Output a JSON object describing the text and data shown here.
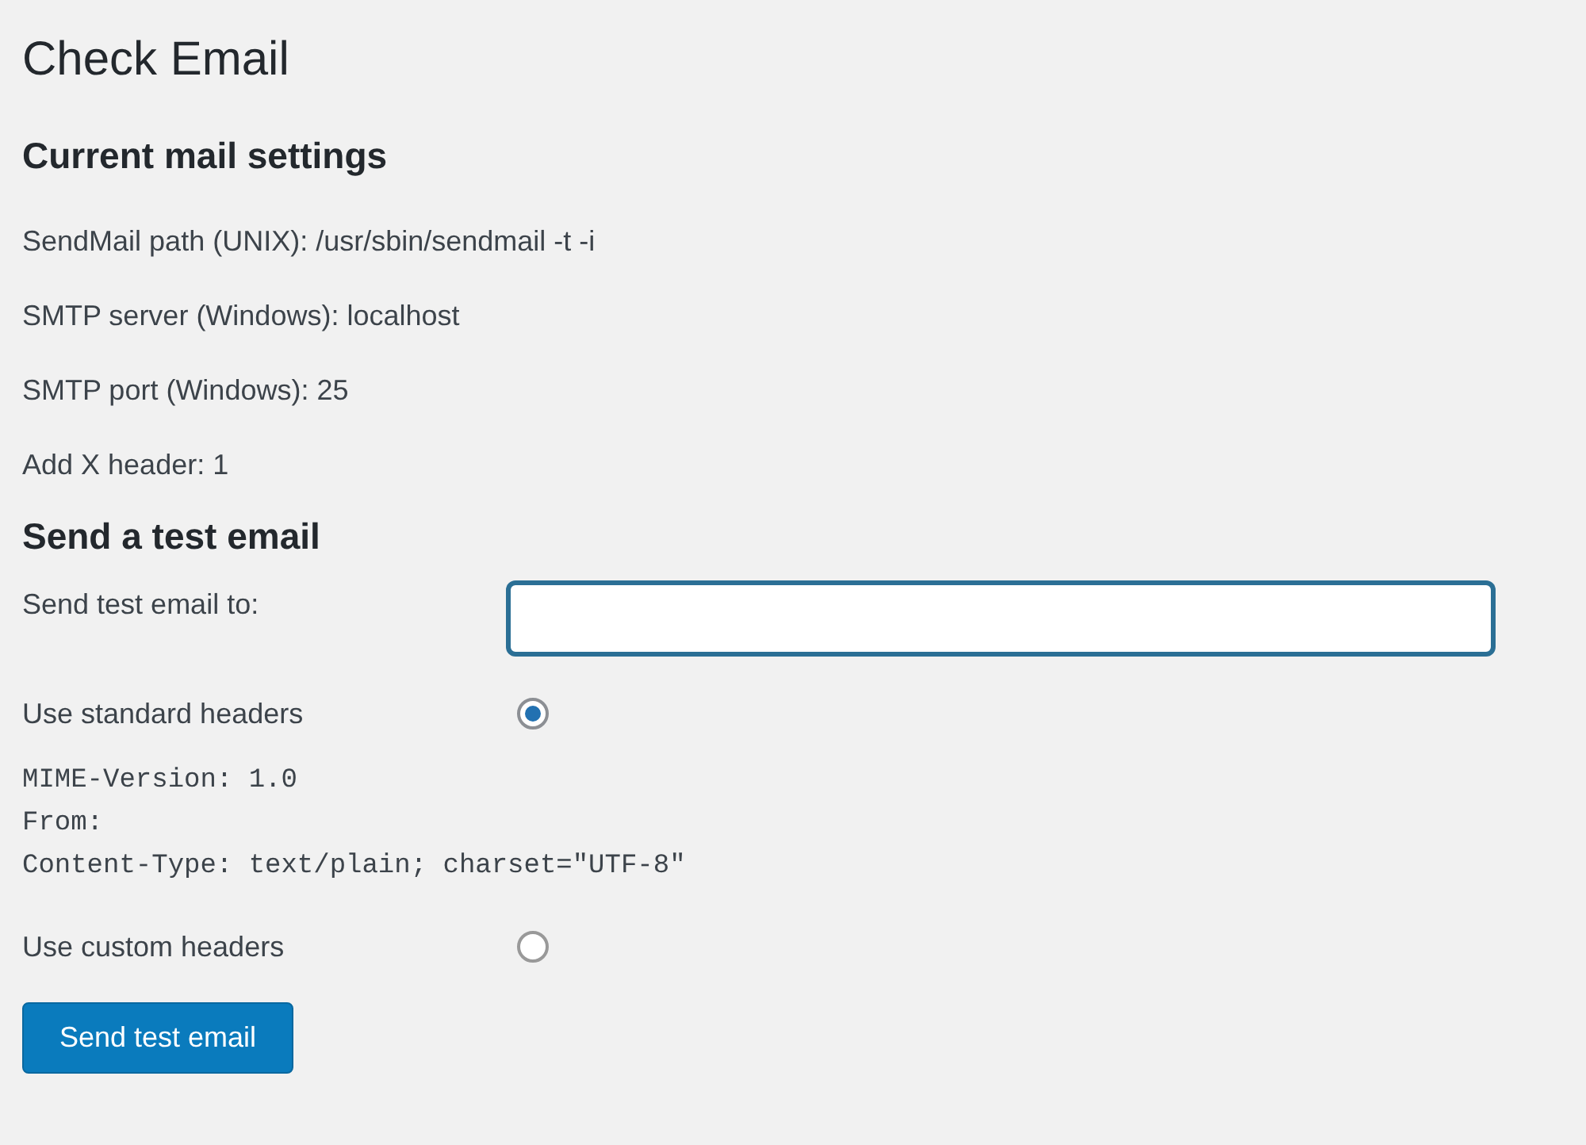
{
  "title": "Check Email",
  "settings": {
    "heading": "Current mail settings",
    "lines": [
      "SendMail path (UNIX): /usr/sbin/sendmail -t -i",
      "SMTP server (Windows): localhost",
      "SMTP port (Windows): 25",
      "Add X header: 1"
    ]
  },
  "test": {
    "heading": "Send a test email",
    "to_label": "Send test email to:",
    "to_field": {
      "focused": true
    },
    "header_options": [
      {
        "label": "Use standard headers",
        "selected": true,
        "headers": [
          "MIME-Version: 1.0",
          "From:",
          "Content-Type: text/plain; charset=\"UTF-8\""
        ]
      },
      {
        "label": "Use custom headers",
        "selected": false
      }
    ],
    "button": "Send test email"
  }
}
